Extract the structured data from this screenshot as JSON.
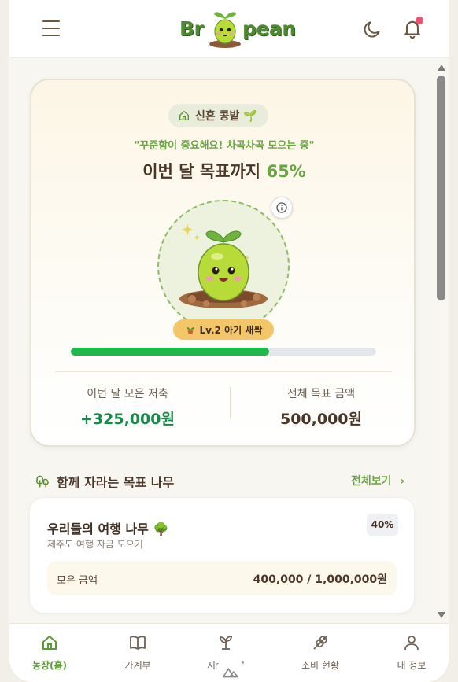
{
  "header": {
    "logo_text_left": "Br",
    "logo_text_right": "pean",
    "notification_dot": true
  },
  "farm": {
    "badge_label": "신혼 콩밭 🌱",
    "quote": "\"꾸준함이 중요해요! 차곡차곡 모으는 중\"",
    "goal_title": "이번 달 목표까지",
    "goal_percent": "65%",
    "progress_fraction": 0.65,
    "level_label": "Lv.2 아기 새싹",
    "saved_label": "이번 달 모은 저축",
    "saved_value": "+325,000원",
    "target_label": "전체 목표 금액",
    "target_value": "500,000원"
  },
  "trees_section": {
    "title": "함께 자라는 목표 나무",
    "see_all": "전체보기"
  },
  "tree_card": {
    "name": "우리들의 여행 나무 🌳",
    "desc": "제주도 여행 자금 모으기",
    "percent": "40%",
    "amount_label": "모은 금액",
    "amount_value": "400,000 / 1,000,000원"
  },
  "nav": {
    "items": [
      {
        "label": "농장(홈)",
        "icon": "home-icon"
      },
      {
        "label": "가계부",
        "icon": "book-icon"
      },
      {
        "label": "지출 분석",
        "icon": "sprout-icon"
      },
      {
        "label": "소비 현황",
        "icon": "wheat-icon"
      },
      {
        "label": "내 정보",
        "icon": "user-icon"
      }
    ]
  },
  "colors": {
    "accent_green": "#6aa543",
    "progress_green": "#1fb84a",
    "level_yellow": "#f4c66a",
    "text_brown": "#4a3628"
  }
}
